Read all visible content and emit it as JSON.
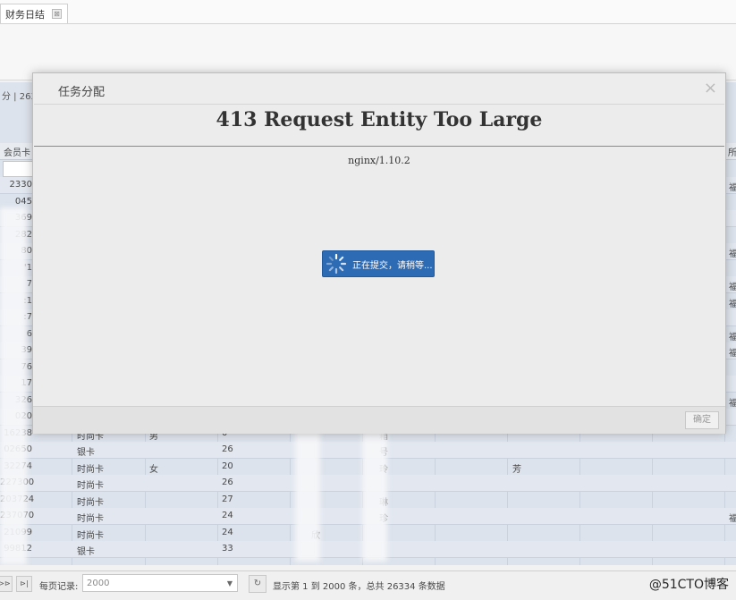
{
  "tabs": [
    {
      "label": "财务日结",
      "close_glyph": "⊠"
    }
  ],
  "grid": {
    "info_text": "分 | 263",
    "header": {
      "card_col": "会员卡",
      "right_col": "所"
    },
    "rows": [
      {
        "id": "2330",
        "type": "",
        "gender": "",
        "age": "",
        "name": "",
        "note": "",
        "right": "福"
      },
      {
        "id": "045",
        "type": "",
        "gender": "",
        "age": "",
        "name": "",
        "note": "",
        "right": ""
      },
      {
        "id": "369",
        "type": "",
        "gender": "",
        "age": "",
        "name": "",
        "note": "",
        "right": ""
      },
      {
        "id": "282",
        "type": "",
        "gender": "",
        "age": "",
        "name": "",
        "note": "",
        "right": ""
      },
      {
        "id": "80",
        "type": "",
        "gender": "",
        "age": "",
        "name": "",
        "note": "",
        "right": "福"
      },
      {
        "id": "'1",
        "type": "",
        "gender": "",
        "age": "",
        "name": "",
        "note": "",
        "right": ""
      },
      {
        "id": "7",
        "type": "",
        "gender": "",
        "age": "",
        "name": "",
        "note": "",
        "right": "福"
      },
      {
        "id": ":1",
        "type": "",
        "gender": "",
        "age": "",
        "name": "",
        "note": "",
        "right": "福"
      },
      {
        "id": ":7",
        "type": "",
        "gender": "",
        "age": "",
        "name": "",
        "note": "",
        "right": ""
      },
      {
        "id": "6",
        "type": "",
        "gender": "",
        "age": "",
        "name": "",
        "note": "",
        "right": "福"
      },
      {
        "id": "39",
        "type": "",
        "gender": "",
        "age": "",
        "name": "",
        "note": "",
        "right": "福"
      },
      {
        "id": "76",
        "type": "",
        "gender": "",
        "age": "",
        "name": "",
        "note": "",
        "right": ""
      },
      {
        "id": "17",
        "type": "",
        "gender": "",
        "age": "",
        "name": "",
        "note": "",
        "right": ""
      },
      {
        "id": "326",
        "type": "",
        "gender": "",
        "age": "",
        "name": "",
        "note": "",
        "right": "福"
      },
      {
        "id": "020",
        "type": "",
        "gender": "",
        "age": "",
        "name": "",
        "note": "",
        "right": ""
      },
      {
        "id": "16238",
        "type": "时尚卡",
        "gender": "男",
        "age": "0",
        "name": "",
        "note": "箱",
        "right": ""
      },
      {
        "id": "02650",
        "type": "银卡",
        "gender": "",
        "age": "26",
        "name": "",
        "note": "号",
        "right": ""
      },
      {
        "id": "32274",
        "type": "时尚卡",
        "gender": "女",
        "age": "20",
        "name": "",
        "note": "玲",
        "right": "芳"
      },
      {
        "id": "227300",
        "type": "时尚卡",
        "gender": "",
        "age": "26",
        "name": "",
        "note": "",
        "right": ""
      },
      {
        "id": "203724",
        "type": "时尚卡",
        "gender": "",
        "age": "27",
        "name": "",
        "note": "琳",
        "right": ""
      },
      {
        "id": "237070",
        "type": "时尚卡",
        "gender": "",
        "age": "24",
        "name": "",
        "note": "珍",
        "right": "福"
      },
      {
        "id": "21099",
        "type": "时尚卡",
        "gender": "",
        "age": "24",
        "name": "欣",
        "note": "",
        "right": ""
      },
      {
        "id": "99812",
        "type": "银卡",
        "gender": "",
        "age": "33",
        "name": "",
        "note": "",
        "right": ""
      }
    ]
  },
  "pagination": {
    "first_glyph": "⊳⊳",
    "last_glyph": "⊳|",
    "page_size_label": "每页记录:",
    "page_size_value": "2000",
    "refresh_glyph": "↻",
    "summary": "显示第 1 到 2000 条，总共 26334 条数据"
  },
  "watermark": "@51CTO博客",
  "modal": {
    "title": "任务分配",
    "close_glyph": "×",
    "error_title": "413 Request Entity Too Large",
    "server": "nginx/1.10.2",
    "confirm_label": "确定"
  },
  "loading": {
    "text": "正在提交，请稍等...",
    "icon": "spinner-icon"
  }
}
